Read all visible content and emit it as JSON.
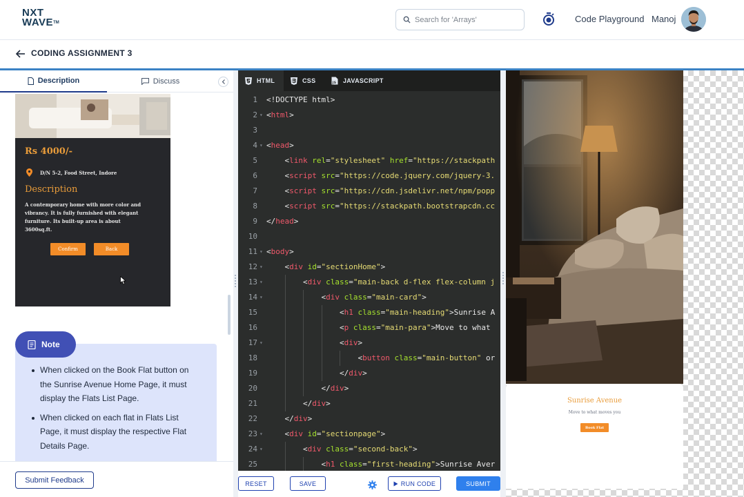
{
  "brand": {
    "line1": "NXT",
    "line2": "WAVE",
    "tm": "TM"
  },
  "header": {
    "search_placeholder": "Search for 'Arrays'",
    "playground": "Code Playground",
    "user": "Manoj"
  },
  "assignment": {
    "title": "CODING ASSIGNMENT 3"
  },
  "tabs": {
    "description": "Description",
    "discuss": "Discuss"
  },
  "card": {
    "price": "Rs 4000/-",
    "address": "D/N 5-2, Food Street, Indore",
    "heading": "Description",
    "para": "A contemporary home with more color and vibrancy. It is fully furnished with elegant furniture. Its built-up area is about 3600sq.ft.",
    "confirm": "Confirm",
    "back": "Back"
  },
  "note": {
    "title": "Note",
    "items": [
      "When clicked on the Book Flat button on the Sunrise Avenue Home Page, it must display the Flats List Page.",
      "When clicked on each flat in Flats List Page, it must display the respective Flat Details Page."
    ]
  },
  "feedback": "Submit Feedback",
  "editor": {
    "tabs": {
      "html": "HTML",
      "css": "CSS",
      "js": "JAVASCRIPT"
    },
    "lines": [
      "<!DOCTYPE html>",
      "<html>",
      "",
      "<head>",
      "<link rel=\"stylesheet\" href=\"https://stackpath",
      "<script src=\"https://code.jquery.com/jquery-3.",
      "<script src=\"https://cdn.jsdelivr.net/npm/popp",
      "<script src=\"https://stackpath.bootstrapcdn.cc",
      "</head>",
      "",
      "<body>",
      "<div id=\"sectionHome\">",
      "<div class=\"main-back d-flex flex-column j",
      "<div class=\"main-card\">",
      "<h1 class=\"main-heading\">Sunrise A",
      "<p class=\"main-para\">Move to what",
      "<div>",
      "<button class=\"main-button\" or",
      "</div>",
      "</div>",
      "</div>",
      "</div>",
      "<div id=\"sectionpage\">",
      "<div class=\"second-back\">",
      "<h1 class=\"first-heading\">Sunrise Aver"
    ],
    "buttons": {
      "reset": "RESET",
      "save": "SAVE",
      "run": "RUN CODE",
      "submit": "SUBMIT"
    }
  },
  "preview": {
    "heading": "Sunrise Avenue",
    "para": "Move to what moves you",
    "button": "Book Flat"
  },
  "colors": {
    "accent": "#f28c28",
    "primary": "#1e40af",
    "note_bg": "#dde4fb",
    "editor_bg": "#2b2d2c"
  }
}
